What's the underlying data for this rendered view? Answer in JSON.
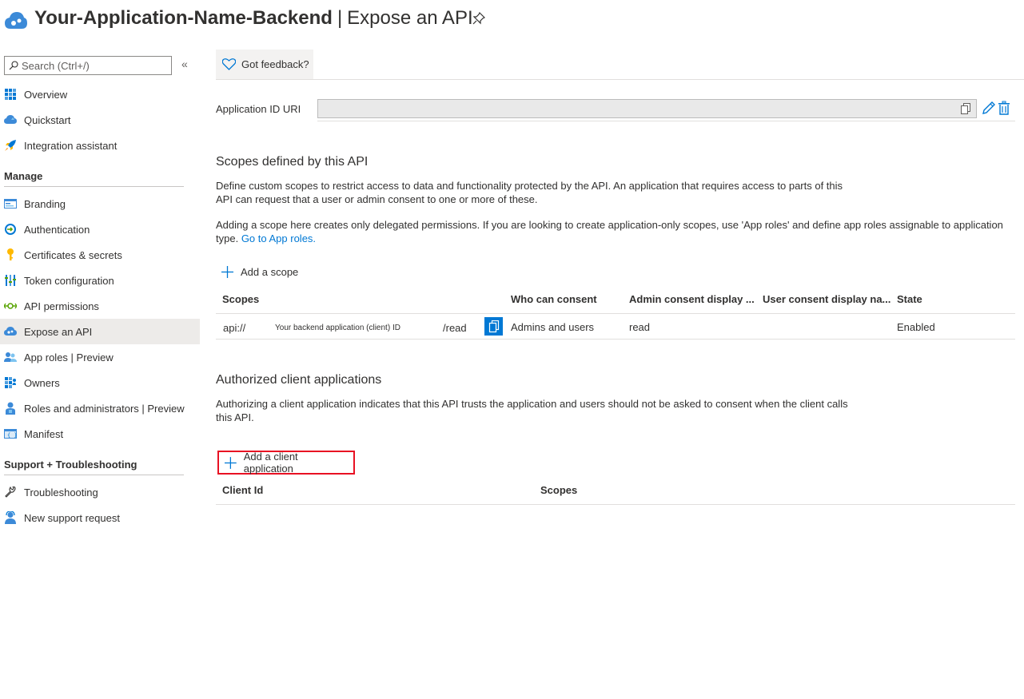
{
  "header": {
    "app_name": "Your-Application-Name-Backend",
    "separator": "|",
    "page_title": "Expose an API"
  },
  "sidebar": {
    "search_placeholder": "Search (Ctrl+/)",
    "collapse_glyph": "«",
    "top_items": [
      {
        "label": "Overview",
        "icon": "overview-icon"
      },
      {
        "label": "Quickstart",
        "icon": "quickstart-icon"
      },
      {
        "label": "Integration assistant",
        "icon": "rocket-icon"
      }
    ],
    "manage_header": "Manage",
    "manage_items": [
      {
        "label": "Branding",
        "icon": "branding-icon"
      },
      {
        "label": "Authentication",
        "icon": "authentication-icon"
      },
      {
        "label": "Certificates & secrets",
        "icon": "key-icon"
      },
      {
        "label": "Token configuration",
        "icon": "token-icon"
      },
      {
        "label": "API permissions",
        "icon": "api-permissions-icon"
      },
      {
        "label": "Expose an API",
        "icon": "cloud-icon",
        "active": true
      },
      {
        "label": "App roles | Preview",
        "icon": "app-roles-icon"
      },
      {
        "label": "Owners",
        "icon": "owners-icon"
      },
      {
        "label": "Roles and administrators | Preview",
        "icon": "admin-roles-icon"
      },
      {
        "label": "Manifest",
        "icon": "manifest-icon"
      }
    ],
    "support_header": "Support + Troubleshooting",
    "support_items": [
      {
        "label": "Troubleshooting",
        "icon": "wrench-icon"
      },
      {
        "label": "New support request",
        "icon": "support-person-icon"
      }
    ]
  },
  "commandbar": {
    "feedback_label": "Got feedback?"
  },
  "app_id_uri": {
    "label": "Application ID URI",
    "value": ""
  },
  "scopes_section": {
    "title": "Scopes defined by this API",
    "desc1": "Define custom scopes to restrict access to data and functionality protected by the API. An application that requires access to parts of this API can request that a user or admin consent to one or more of these.",
    "desc2_prefix": "Adding a scope here creates only delegated permissions. If you are looking to create application-only scopes, use 'App roles' and define app roles assignable to application type.",
    "desc2_link": "Go to App roles.",
    "add_label": "Add a scope",
    "columns": [
      "Scopes",
      "Who can consent",
      "Admin consent display ...",
      "User consent display na...",
      "State"
    ],
    "rows": [
      {
        "scope_prefix": "api://",
        "scope_middle": "Your backend application (client) ID",
        "scope_suffix": "/read",
        "who": "Admins and users",
        "admin_display": "read",
        "user_display": "",
        "state": "Enabled"
      }
    ]
  },
  "authorized_section": {
    "title": "Authorized client applications",
    "desc": "Authorizing a client application indicates that this API trusts the application and users should not be asked to consent when the client calls this API.",
    "add_label": "Add a client application",
    "columns": [
      "Client Id",
      "Scopes"
    ]
  },
  "colors": {
    "accent": "#0078d4",
    "highlight": "#e81123",
    "active_nav": "#edebe9"
  }
}
